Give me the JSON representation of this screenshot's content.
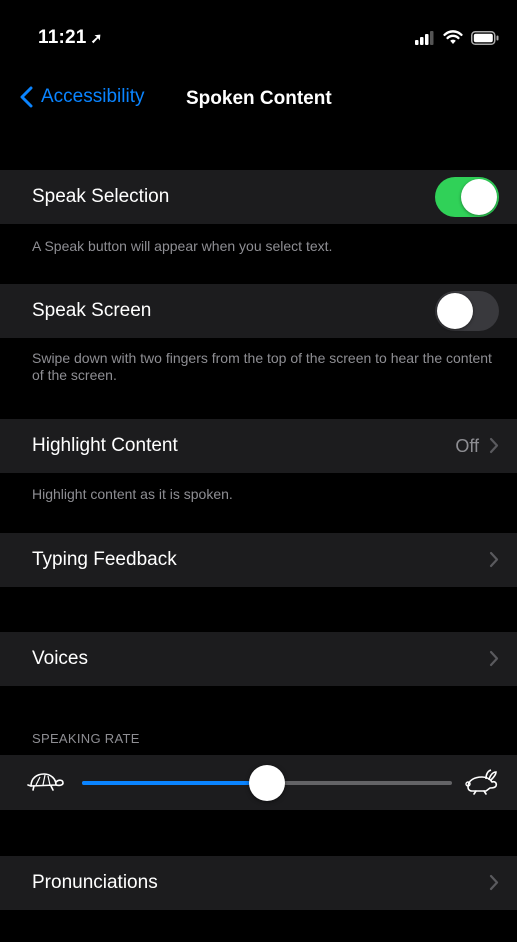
{
  "status": {
    "time": "11:21",
    "location_glyph": "➚"
  },
  "nav": {
    "back_label": "Accessibility",
    "title": "Spoken Content"
  },
  "rows": {
    "speak_selection": {
      "label": "Speak Selection",
      "toggle": "on",
      "footer": "A Speak button will appear when you select text."
    },
    "speak_screen": {
      "label": "Speak Screen",
      "toggle": "off",
      "footer": "Swipe down with two fingers from the top of the screen to hear the content of the screen."
    },
    "highlight_content": {
      "label": "Highlight Content",
      "value": "Off",
      "footer": "Highlight content as it is spoken."
    },
    "typing_feedback": {
      "label": "Typing Feedback"
    },
    "voices": {
      "label": "Voices"
    },
    "pronunciations": {
      "label": "Pronunciations"
    }
  },
  "speaking_rate": {
    "header": "SPEAKING RATE",
    "value_fraction": 0.5
  },
  "colors": {
    "accent": "#0a84ff",
    "toggle_on": "#30d158",
    "background": "#000000",
    "cell": "#1c1c1e",
    "secondary_text": "#8e8e93"
  },
  "icons": {
    "slow": "turtle-icon",
    "fast": "hare-icon",
    "chevron": "chevron-right-icon",
    "back": "chevron-left-icon"
  }
}
